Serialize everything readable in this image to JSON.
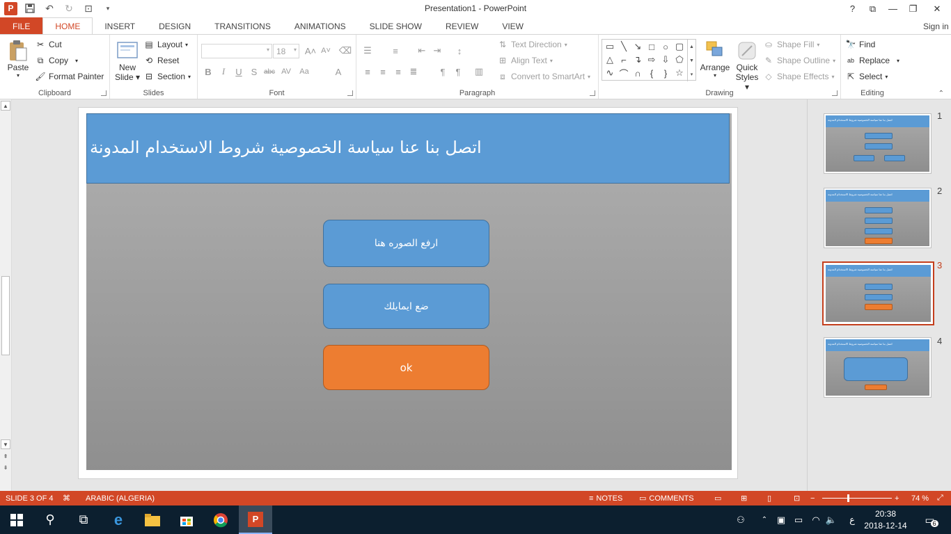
{
  "window": {
    "title": "Presentation1 - PowerPoint",
    "help": "?",
    "ribbon_display": "⧉",
    "minimize": "—",
    "restore": "❐",
    "close": "✕"
  },
  "tabs": [
    "FILE",
    "HOME",
    "INSERT",
    "DESIGN",
    "TRANSITIONS",
    "ANIMATIONS",
    "SLIDE SHOW",
    "REVIEW",
    "VIEW"
  ],
  "active_tab": "HOME",
  "sign_in": "Sign in",
  "ribbon": {
    "clipboard": {
      "label": "Clipboard",
      "paste": "Paste",
      "cut": "Cut",
      "copy": "Copy",
      "format_painter": "Format Painter"
    },
    "slides": {
      "label": "Slides",
      "new_slide": "New Slide",
      "new": "New",
      "slide": "Slide",
      "layout": "Layout",
      "reset": "Reset",
      "section": "Section"
    },
    "font": {
      "label": "Font",
      "font_name": "",
      "font_size": "18"
    },
    "paragraph": {
      "label": "Paragraph",
      "text_direction": "Text Direction",
      "align_text": "Align Text",
      "convert_smartart": "Convert to SmartArt"
    },
    "drawing": {
      "label": "Drawing",
      "arrange": "Arrange",
      "quick": "Quick",
      "styles": "Styles",
      "shape_fill": "Shape Fill",
      "shape_outline": "Shape Outline",
      "shape_effects": "Shape Effects"
    },
    "editing": {
      "label": "Editing",
      "find": "Find",
      "replace": "Replace",
      "select": "Select"
    }
  },
  "slide": {
    "header": "اتصل بنا  عنا  سياسة الخصوصية شروط الاستخدام  المدونة",
    "buttons": [
      "ارفع الصوره هنا",
      "ضع ايمايلك",
      "ok"
    ],
    "colors": {
      "blue": "#5b9bd5",
      "orange": "#ed7d31"
    }
  },
  "thumbnails": [
    {
      "number": "1",
      "selected": false
    },
    {
      "number": "2",
      "selected": false
    },
    {
      "number": "3",
      "selected": true
    },
    {
      "number": "4",
      "selected": false
    }
  ],
  "status": {
    "slide_indicator": "SLIDE 3 OF 4",
    "language": "ARABIC (ALGERIA)",
    "notes": "NOTES",
    "comments": "COMMENTS",
    "zoom": "74 %",
    "zoom_minus": "−",
    "zoom_plus": "+"
  },
  "taskbar": {
    "time": "20:38",
    "date": "2018-12-14",
    "language": "ع",
    "notifications": "6"
  }
}
